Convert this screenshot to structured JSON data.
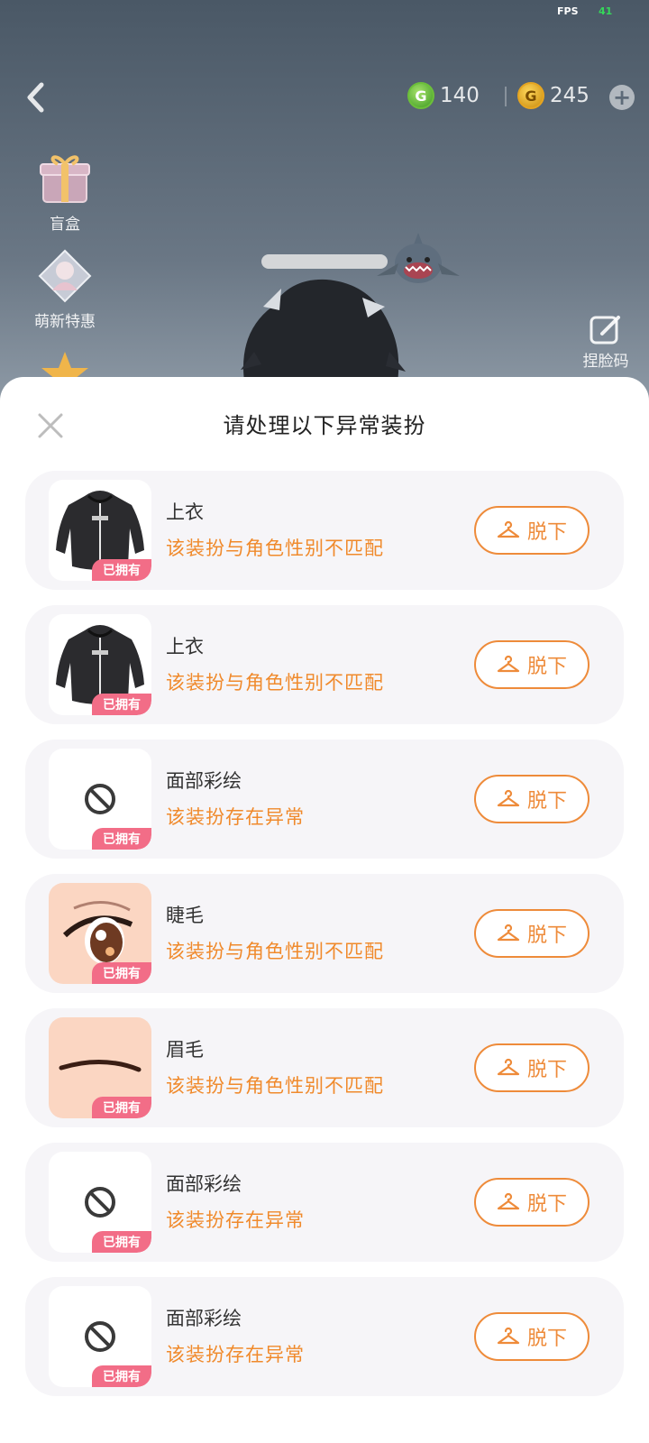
{
  "status": {
    "fps_label": "FPS",
    "fps_value": "41"
  },
  "header": {
    "currency_green": "140",
    "currency_gold": "245"
  },
  "side_menu": {
    "blind_box": "盲盒",
    "newbie_special": "萌新特惠"
  },
  "face_code": "捏脸码",
  "sheet": {
    "title": "请处理以下异常装扮",
    "owned_badge": "已拥有",
    "remove_label": "脱下",
    "items": [
      {
        "name": "上衣",
        "warning": "该装扮与角色性别不匹配",
        "thumb": "hoodie"
      },
      {
        "name": "上衣",
        "warning": "该装扮与角色性别不匹配",
        "thumb": "hoodie"
      },
      {
        "name": "面部彩绘",
        "warning": "该装扮存在异常",
        "thumb": "forbidden"
      },
      {
        "name": "睫毛",
        "warning": "该装扮与角色性别不匹配",
        "thumb": "eye"
      },
      {
        "name": "眉毛",
        "warning": "该装扮与角色性别不匹配",
        "thumb": "eyebrow"
      },
      {
        "name": "面部彩绘",
        "warning": "该装扮存在异常",
        "thumb": "forbidden"
      },
      {
        "name": "面部彩绘",
        "warning": "该装扮存在异常",
        "thumb": "forbidden"
      }
    ]
  },
  "colors": {
    "accent_orange": "#ee8b3a",
    "warning_text": "#f08a2c",
    "badge_pink": "#f26d87"
  }
}
